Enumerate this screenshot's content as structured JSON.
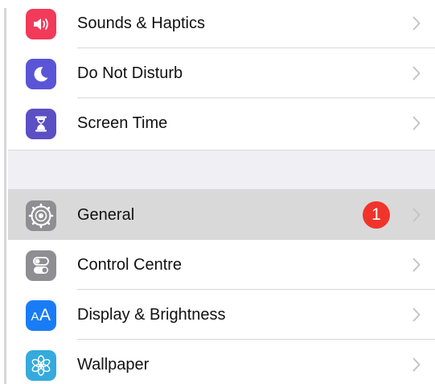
{
  "settings": {
    "group1": [
      {
        "label": "Sounds & Haptics",
        "icon": "speaker-icon",
        "color": "#f23a5a"
      },
      {
        "label": "Do Not Disturb",
        "icon": "moon-icon",
        "color": "#5a55d6"
      },
      {
        "label": "Screen Time",
        "icon": "hourglass-icon",
        "color": "#5c4fc4"
      }
    ],
    "group2": [
      {
        "label": "General",
        "icon": "gear-icon",
        "color": "#8e8e93",
        "badge": "1"
      },
      {
        "label": "Control Centre",
        "icon": "toggles-icon",
        "color": "#8e8e93"
      },
      {
        "label": "Display & Brightness",
        "icon": "text-size-icon",
        "color": "#1a7cf5",
        "icon_text_small": "A",
        "icon_text_big": "A"
      },
      {
        "label": "Wallpaper",
        "icon": "flower-icon",
        "color": "#35aadc"
      }
    ]
  },
  "colors": {
    "chevron": "#c4c4c7",
    "badge": "#f0342b",
    "highlight": "#d9d9d9",
    "section_gap": "#efeff4"
  }
}
